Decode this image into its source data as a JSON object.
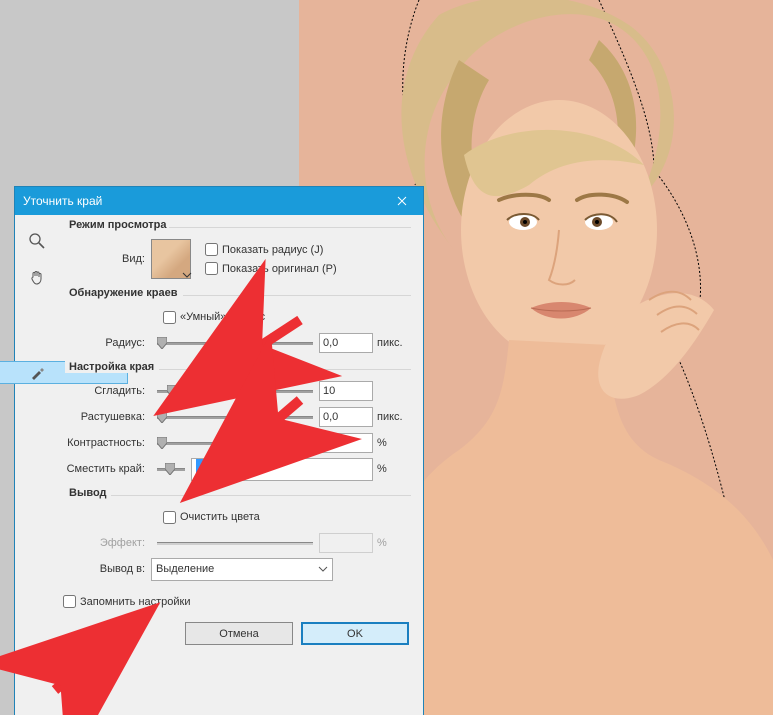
{
  "dialog": {
    "title": "Уточнить край",
    "sections": {
      "view_mode": {
        "title": "Режим просмотра",
        "view_label": "Вид:",
        "show_radius": {
          "label": "Показать радиус (J)",
          "checked": false
        },
        "show_original": {
          "label": "Показать оригинал (P)",
          "checked": false
        }
      },
      "edge_detection": {
        "title": "Обнаружение краев",
        "smart_radius": {
          "label": "«Умный» радиус",
          "checked": false
        },
        "radius": {
          "label": "Радиус:",
          "value": "0,0",
          "unit": "пикс."
        }
      },
      "edge_adjust": {
        "title": "Настройка края",
        "smooth": {
          "label": "Сгладить:",
          "value": "10"
        },
        "feather": {
          "label": "Растушевка:",
          "value": "0,0",
          "unit": "пикс."
        },
        "contrast": {
          "label": "Контрастность:",
          "value": "0",
          "unit": "%"
        },
        "shift": {
          "label": "Сместить край:",
          "value": "-10",
          "unit": "%"
        }
      },
      "output": {
        "title": "Вывод",
        "decontaminate": {
          "label": "Очистить цвета",
          "checked": false
        },
        "effect": {
          "label": "Эффект:",
          "value": "",
          "unit": "%"
        },
        "output_to_label": "Вывод в:",
        "output_to_value": "Выделение"
      }
    },
    "remember": {
      "label": "Запомнить настройки",
      "checked": false
    },
    "buttons": {
      "cancel": "Отмена",
      "ok": "OK"
    }
  },
  "icons": {
    "zoom": "zoom-icon",
    "hand": "hand-icon",
    "refine": "brush-icon",
    "close": "close-icon",
    "dropdown": "chevron-down-icon"
  }
}
